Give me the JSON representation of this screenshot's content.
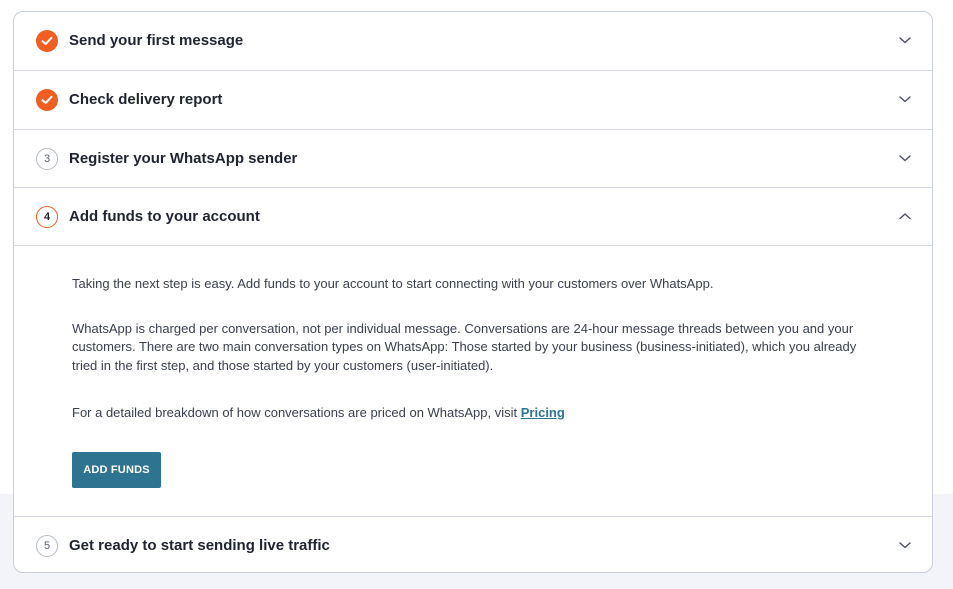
{
  "steps": [
    {
      "number": "1",
      "title": "Send your first message",
      "status": "done",
      "icon": "check-icon",
      "expanded": false
    },
    {
      "number": "2",
      "title": "Check delivery report",
      "status": "done",
      "icon": "check-icon",
      "expanded": false
    },
    {
      "number": "3",
      "title": "Register your WhatsApp sender",
      "status": "pending",
      "expanded": false
    },
    {
      "number": "4",
      "title": "Add funds to your account",
      "status": "active",
      "expanded": true
    },
    {
      "number": "5",
      "title": "Get ready to start sending live traffic",
      "status": "pending",
      "expanded": false
    }
  ],
  "panel": {
    "para1": "Taking the next step is easy. Add funds to your account to start connecting with your customers over WhatsApp.",
    "para2": "WhatsApp is charged per conversation, not per individual message. Conversations are 24-hour message threads between you and your customers. There are two main conversation types on WhatsApp: Those started by your business (business-initiated), which you already tried in the first step, and those started by your customers (user-initiated).",
    "para3_text": "For a detailed breakdown of how conversations are priced on WhatsApp, visit ",
    "para3_link": "Pricing",
    "button_label": "ADD FUNDS"
  },
  "colors": {
    "accent_orange": "#f25d22",
    "button_teal": "#2e7491",
    "link": "#2a7590",
    "border": "#d3d8e4"
  }
}
